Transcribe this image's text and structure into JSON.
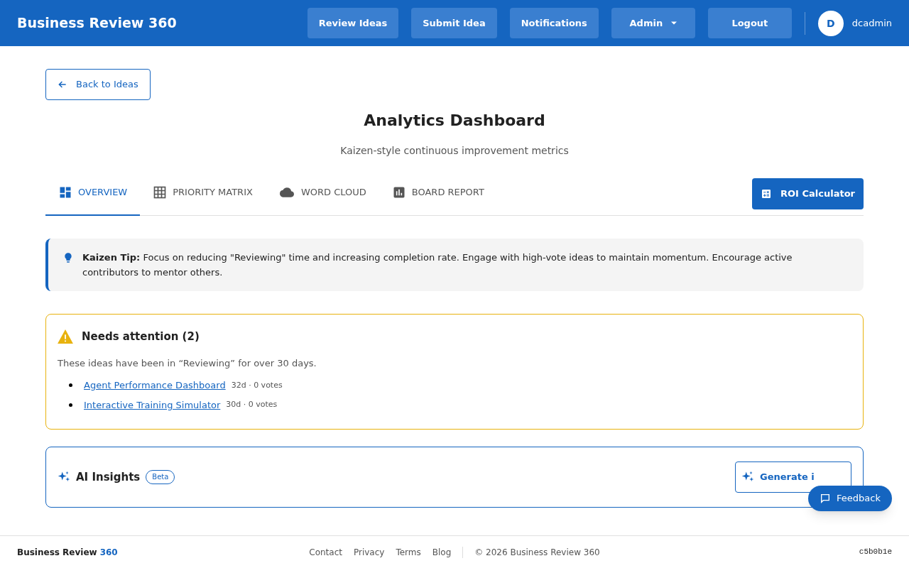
{
  "header": {
    "brand": "Business Review 360",
    "nav": [
      {
        "label": "Review Ideas",
        "kind": "link"
      },
      {
        "label": "Submit Idea",
        "kind": "link"
      },
      {
        "label": "Notifications",
        "kind": "link"
      },
      {
        "label": "Admin",
        "kind": "dropdown"
      },
      {
        "label": "Logout",
        "kind": "link"
      }
    ],
    "user": {
      "initial": "D",
      "name": "dcadmin"
    }
  },
  "back_button": "Back to Ideas",
  "title": "Analytics Dashboard",
  "subtitle": "Kaizen-style continuous improvement metrics",
  "tabs": [
    {
      "label": "OVERVIEW",
      "kind": "overview",
      "selected": true
    },
    {
      "label": "PRIORITY MATRIX",
      "kind": "grid",
      "selected": false
    },
    {
      "label": "WORD CLOUD",
      "kind": "cloud",
      "selected": false
    },
    {
      "label": "BOARD REPORT",
      "kind": "chart",
      "selected": false
    }
  ],
  "roi_button": "ROI Calculator",
  "tip": {
    "text": "**Kaizen Tip:** Focus on reducing \"Reviewing\" time and increasing completion rate. Engage with high-vote ideas to maintain momentum. Encourage active contributors to mentor others."
  },
  "attention": {
    "title": "Needs attention (2)",
    "description": "These ideas have been in “Reviewing” for over 30 days.",
    "items": [
      {
        "title": "Agent Performance Dashboard",
        "meta": "32d · 0 votes"
      },
      {
        "title": "Interactive Training Simulator",
        "meta": "30d · 0 votes"
      }
    ]
  },
  "ai_insights": {
    "title": "AI Insights",
    "badge": "Beta",
    "button": "Generate i"
  },
  "feedback_button": "Feedback",
  "footer": {
    "brand": "Business Review",
    "brand_accent": "360",
    "links": [
      "Contact",
      "Privacy",
      "Terms",
      "Blog"
    ],
    "copyright": "© 2026 Business Review 360",
    "version": "c5b0b1e"
  }
}
